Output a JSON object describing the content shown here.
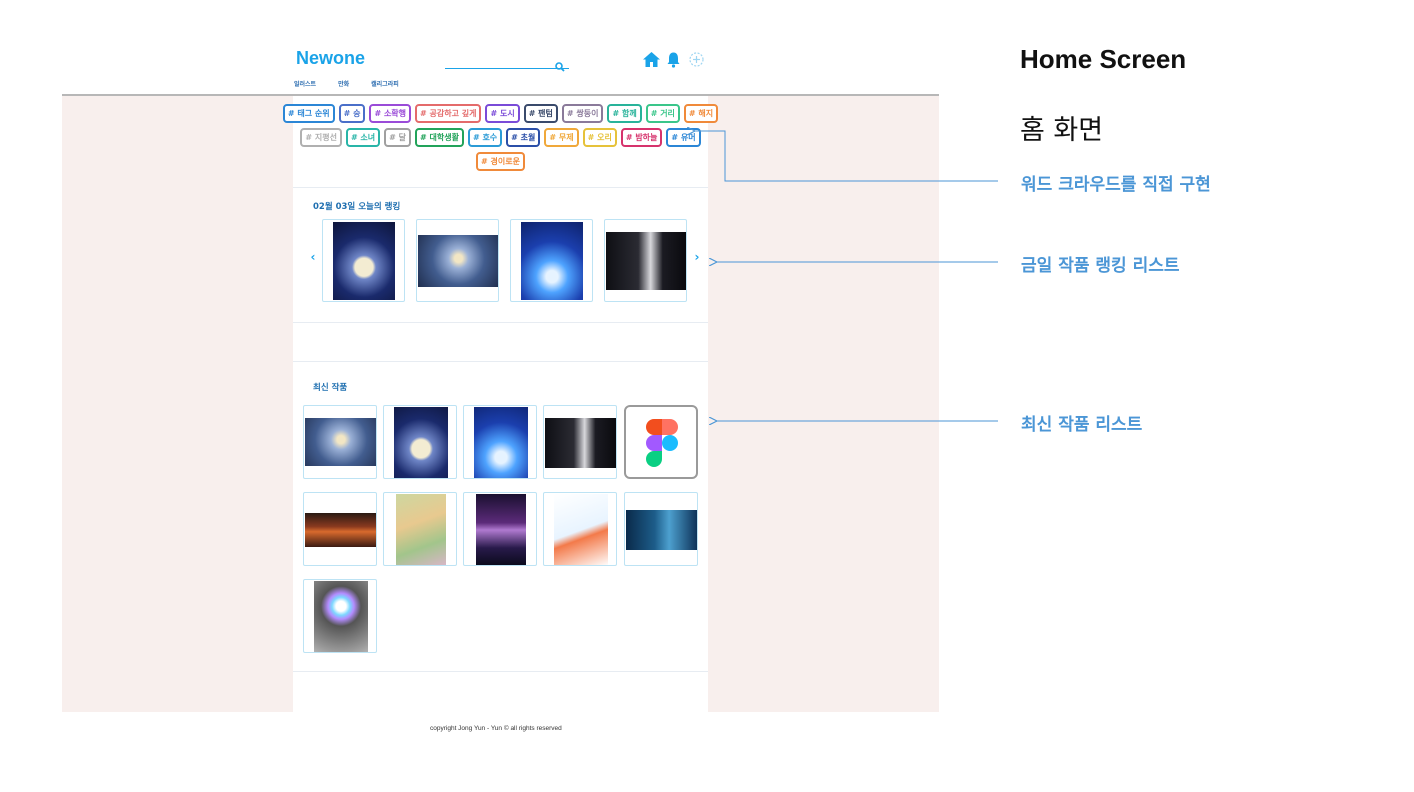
{
  "app": {
    "logo": "Newone",
    "nav": [
      "일러스트",
      "만화",
      "캘리그라피"
    ],
    "search_placeholder": ""
  },
  "tags": {
    "rows": [
      [
        {
          "label": "# 태그 순위",
          "color": "#2b86d6"
        },
        {
          "label": "# 숭",
          "color": "#4a6fc9"
        },
        {
          "label": "# 소확행",
          "color": "#9a4bd8"
        },
        {
          "label": "# 공감하고 깊게",
          "color": "#e46b6b"
        },
        {
          "label": "# 도시",
          "color": "#7a4bd8"
        },
        {
          "label": "# 팬텀",
          "color": "#3a4a6b"
        },
        {
          "label": "# 쌍둥이",
          "color": "#8a7a9a"
        },
        {
          "label": "# 함께",
          "color": "#28b39a"
        },
        {
          "label": "# 거리",
          "color": "#3ac68a"
        },
        {
          "label": "# 해지",
          "color": "#f08a3a"
        }
      ],
      [
        {
          "label": "# 지평선",
          "color": "#b0b0b0"
        },
        {
          "label": "# 소녀",
          "color": "#29b5a8"
        },
        {
          "label": "# 달",
          "color": "#a0a0a0"
        },
        {
          "label": "# 대학생활",
          "color": "#22a35a"
        },
        {
          "label": "# 호수",
          "color": "#2b9bd6"
        },
        {
          "label": "# 초월",
          "color": "#2b4fa8"
        },
        {
          "label": "# 무제",
          "color": "#f0a83a"
        },
        {
          "label": "# 오리",
          "color": "#e6c23a"
        },
        {
          "label": "# 밤하늘",
          "color": "#d6336c"
        },
        {
          "label": "# 유머",
          "color": "#2b86d6"
        }
      ],
      [
        {
          "label": "# 경이로운",
          "color": "#f08a3a"
        }
      ]
    ]
  },
  "ranking": {
    "title": "02월 03일 오늘의 랭킹",
    "items": [
      "moon-girl",
      "night-nebula",
      "blue-moon-sea",
      "dark-portrait"
    ]
  },
  "recent": {
    "title": "최신 작품",
    "items": [
      "night-nebula",
      "moon-girl",
      "blue-moon-sea",
      "dark-portrait",
      "figma-logo",
      "stage",
      "fairy-garden",
      "galaxy",
      "fish",
      "deep-sea",
      "orb"
    ]
  },
  "footer": "copyright Jong Yun - Yun © all rights reserved",
  "annotations": {
    "title": "Home Screen",
    "subtitle": "홈 화면",
    "labels": [
      "워드 크라우드를 직접 구현",
      "금일 작품 랭킹 리스트",
      "최신 작품 리스트"
    ],
    "color": "#4b96d6"
  }
}
